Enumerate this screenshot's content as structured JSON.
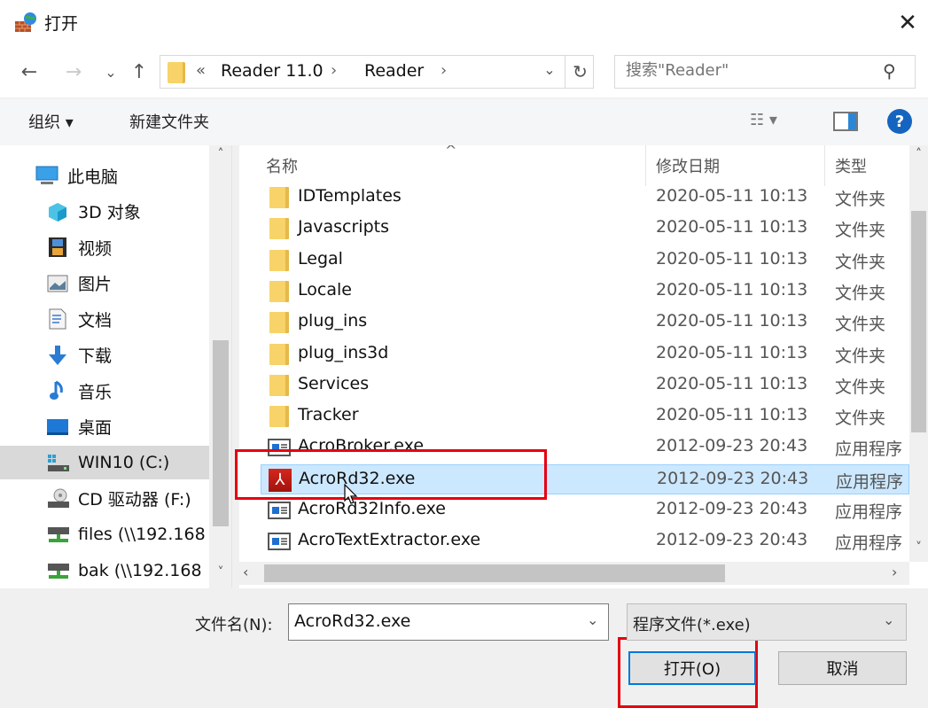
{
  "window": {
    "title": "打开",
    "close_glyph": "✕"
  },
  "nav": {
    "back_glyph": "←",
    "forward_glyph": "→",
    "recent_glyph": "⌄",
    "up_glyph": "↑",
    "breadcrumb_overflow": "«",
    "breadcrumbs": [
      "Reader 11.0",
      "Reader"
    ],
    "breadcrumb_sep": "›",
    "dropdown_glyph": "⌄",
    "refresh_glyph": "↻",
    "search_placeholder": "搜索\"Reader\"",
    "search_glyph": "⚲"
  },
  "toolbar": {
    "organize_label": "组织 ▾",
    "new_folder_label": "新建文件夹",
    "view_label": "☷ ▾",
    "help_label": "?"
  },
  "sidebar": {
    "items": [
      {
        "label": "此电脑",
        "icon": "computer-icon",
        "indent": false
      },
      {
        "label": "3D 对象",
        "icon": "3d-objects-icon",
        "indent": true
      },
      {
        "label": "视频",
        "icon": "video-icon",
        "indent": true
      },
      {
        "label": "图片",
        "icon": "pictures-icon",
        "indent": true
      },
      {
        "label": "文档",
        "icon": "documents-icon",
        "indent": true
      },
      {
        "label": "下载",
        "icon": "download-icon",
        "indent": true
      },
      {
        "label": "音乐",
        "icon": "music-icon",
        "indent": true
      },
      {
        "label": "桌面",
        "icon": "desktop-icon",
        "indent": true
      },
      {
        "label": "WIN10 (C:)",
        "icon": "drive-icon",
        "indent": true,
        "selected": true
      },
      {
        "label": "CD 驱动器 (F:)",
        "icon": "cd-drive-icon",
        "indent": true
      },
      {
        "label": "files (\\\\192.168",
        "icon": "network-drive-icon",
        "indent": true
      },
      {
        "label": "bak (\\\\192.168",
        "icon": "network-drive-icon",
        "indent": true
      }
    ]
  },
  "filelist": {
    "columns": {
      "name": "名称",
      "date": "修改日期",
      "type": "类型"
    },
    "sort_glyph": "^",
    "rows": [
      {
        "name": "IDTemplates",
        "date": "2020-05-11 10:13",
        "type": "文件夹",
        "icon": "folder"
      },
      {
        "name": "Javascripts",
        "date": "2020-05-11 10:13",
        "type": "文件夹",
        "icon": "folder"
      },
      {
        "name": "Legal",
        "date": "2020-05-11 10:13",
        "type": "文件夹",
        "icon": "folder"
      },
      {
        "name": "Locale",
        "date": "2020-05-11 10:13",
        "type": "文件夹",
        "icon": "folder"
      },
      {
        "name": "plug_ins",
        "date": "2020-05-11 10:13",
        "type": "文件夹",
        "icon": "folder"
      },
      {
        "name": "plug_ins3d",
        "date": "2020-05-11 10:13",
        "type": "文件夹",
        "icon": "folder"
      },
      {
        "name": "Services",
        "date": "2020-05-11 10:13",
        "type": "文件夹",
        "icon": "folder"
      },
      {
        "name": "Tracker",
        "date": "2020-05-11 10:13",
        "type": "文件夹",
        "icon": "folder"
      },
      {
        "name": "AcroBroker.exe",
        "date": "2012-09-23 20:43",
        "type": "应用程序",
        "icon": "app"
      },
      {
        "name": "AcroRd32.exe",
        "date": "2012-09-23 20:43",
        "type": "应用程序",
        "icon": "pdf",
        "selected": true
      },
      {
        "name": "AcroRd32Info.exe",
        "date": "2012-09-23 20:43",
        "type": "应用程序",
        "icon": "app"
      },
      {
        "name": "AcroTextExtractor.exe",
        "date": "2012-09-23 20:43",
        "type": "应用程序",
        "icon": "app"
      }
    ]
  },
  "footer": {
    "filename_label": "文件名(N):",
    "filename_value": "AcroRd32.exe",
    "filter_value": "程序文件(*.exe)",
    "dropdown_glyph": "⌄",
    "open_label": "打开(O)",
    "cancel_label": "取消"
  },
  "scroll": {
    "up": "˄",
    "down": "˅",
    "left": "‹",
    "right": "›"
  },
  "colors": {
    "highlight": "#e60012",
    "selection": "#cce8ff",
    "accent": "#0078d7"
  }
}
